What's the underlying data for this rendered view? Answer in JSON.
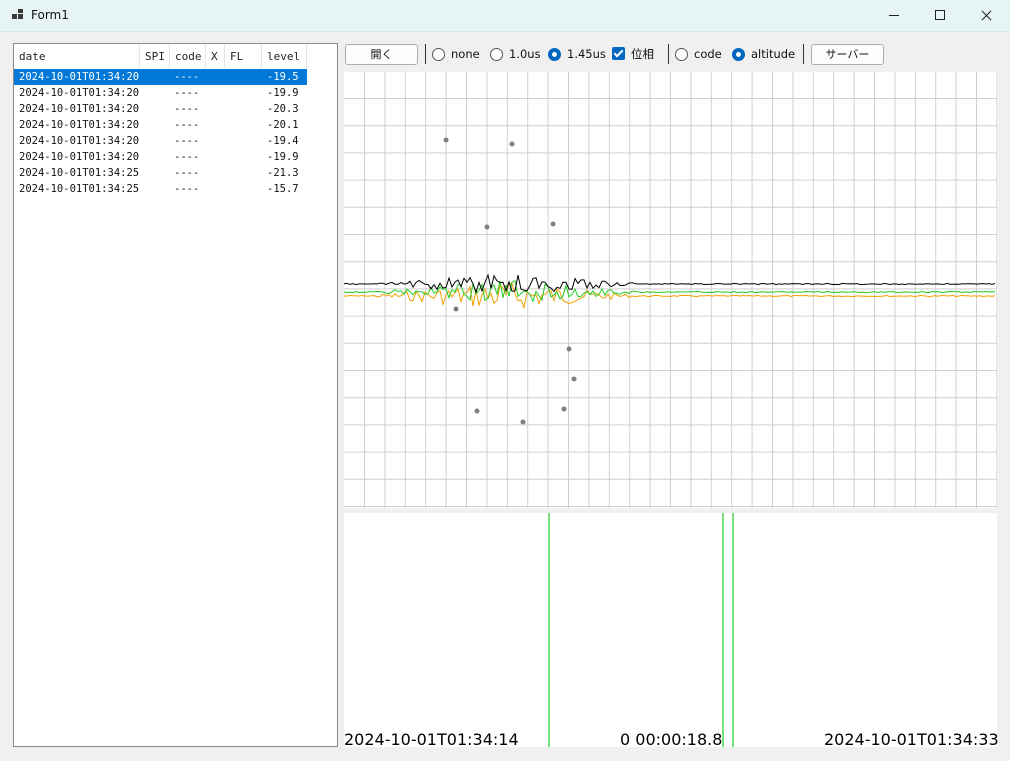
{
  "window": {
    "title": "Form1"
  },
  "list": {
    "columns": [
      "date",
      "SPI",
      "code",
      "X",
      "FL",
      "level"
    ],
    "rows": [
      {
        "date": "2024-10-01T01:34:20",
        "code": "----",
        "level": "-19.5",
        "selected": true
      },
      {
        "date": "2024-10-01T01:34:20",
        "code": "----",
        "level": "-19.9"
      },
      {
        "date": "2024-10-01T01:34:20",
        "code": "----",
        "level": "-20.3"
      },
      {
        "date": "2024-10-01T01:34:20",
        "code": "----",
        "level": "-20.1"
      },
      {
        "date": "2024-10-01T01:34:20",
        "code": "----",
        "level": "-19.4"
      },
      {
        "date": "2024-10-01T01:34:20",
        "code": "----",
        "level": "-19.9"
      },
      {
        "date": "2024-10-01T01:34:25",
        "code": "----",
        "level": "-21.3"
      },
      {
        "date": "2024-10-01T01:34:25",
        "code": "----",
        "level": "-15.7"
      }
    ]
  },
  "toolbar": {
    "open_label": "開く",
    "pulse_options": [
      {
        "label": "none",
        "selected": false
      },
      {
        "label": "1.0us",
        "selected": false
      },
      {
        "label": "1.45us",
        "selected": true
      }
    ],
    "phase_label": "位相",
    "phase_checked": true,
    "mode_options": [
      {
        "label": "code",
        "selected": false
      },
      {
        "label": "altitude",
        "selected": true
      }
    ],
    "server_label": "サーバー"
  },
  "colors": {
    "selection": "#0078d7",
    "series_black": "#000000",
    "series_orange": "#f0a000",
    "series_green": "#22cc22",
    "grid": "#d0d0d0",
    "marker": "#808080",
    "timeline": "#22cc22"
  },
  "timeline": {
    "start_label": "2024-10-01T01:34:14",
    "duration_label": "0 00:00:18.8",
    "end_label": "2024-10-01T01:34:33"
  }
}
